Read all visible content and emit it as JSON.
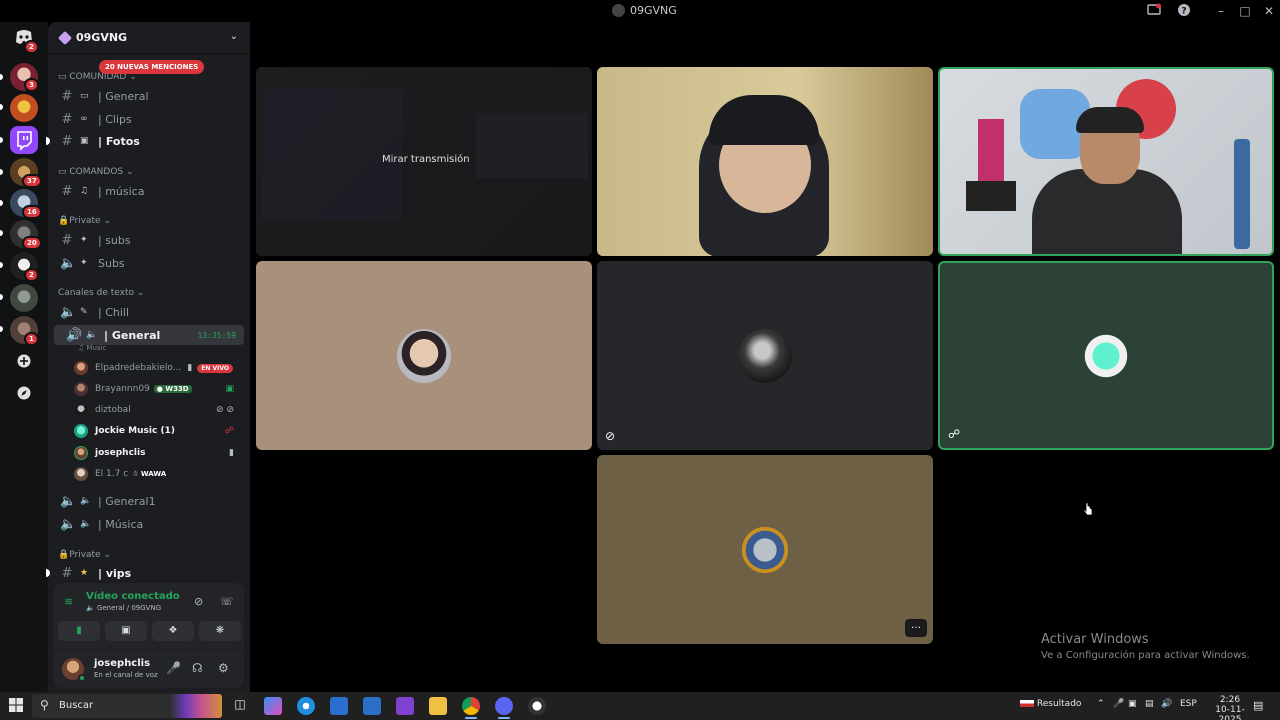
{
  "window": {
    "title": "09GVNG"
  },
  "rail": {
    "badges": [
      "2",
      "3",
      "37",
      "16",
      "20",
      "2",
      "1"
    ]
  },
  "guild": {
    "name": "09GVNG"
  },
  "mentions_pill": "20 NUEVAS MENCIONES",
  "channels": {
    "cat_comunidad": "COMUNIDAD",
    "general": "General",
    "clips": "Clips",
    "fotos": "Fotos",
    "cat_comandos": "COMANDOS",
    "musica_text": "música",
    "cat_private1": "Private",
    "subs_text": "subs",
    "subs_voice": "Subs",
    "cat_canales": "Canales de texto",
    "chill": "Chill",
    "general_voice": "General",
    "general_voice_timer": "13:35:59",
    "general_voice_sub": "Music",
    "general1": "General",
    "musica_voice": "Música",
    "cat_private2": "Private",
    "vips": "vips"
  },
  "members": [
    {
      "name": "Elpadredebakielo...",
      "badge": "EN VIVO"
    },
    {
      "name": "Brayannn09",
      "tag": "W33D"
    },
    {
      "name": "diztobal"
    },
    {
      "name": "Jockie Music (1)"
    },
    {
      "name": "josephclis"
    },
    {
      "name": "El 1.7 c",
      "tag": "WAWA"
    }
  ],
  "voice": {
    "status": "Vídeo conectado",
    "location": "General / 09GVNG"
  },
  "user": {
    "name": "josephclis",
    "status": "En el canal de voz"
  },
  "stage": {
    "watch_label": "Mirar transmisión"
  },
  "watermark": {
    "line1": "Activar Windows",
    "line2": "Ve a Configuración para activar Windows."
  },
  "taskbar": {
    "search_placeholder": "Buscar",
    "weather": "Resultado",
    "lang": "ESP",
    "time": "2:26",
    "date": "10-11-2025"
  },
  "colors": {
    "accent_green": "#23a55a",
    "mention_red": "#da373c",
    "panel_bg": "#1c1d20"
  }
}
